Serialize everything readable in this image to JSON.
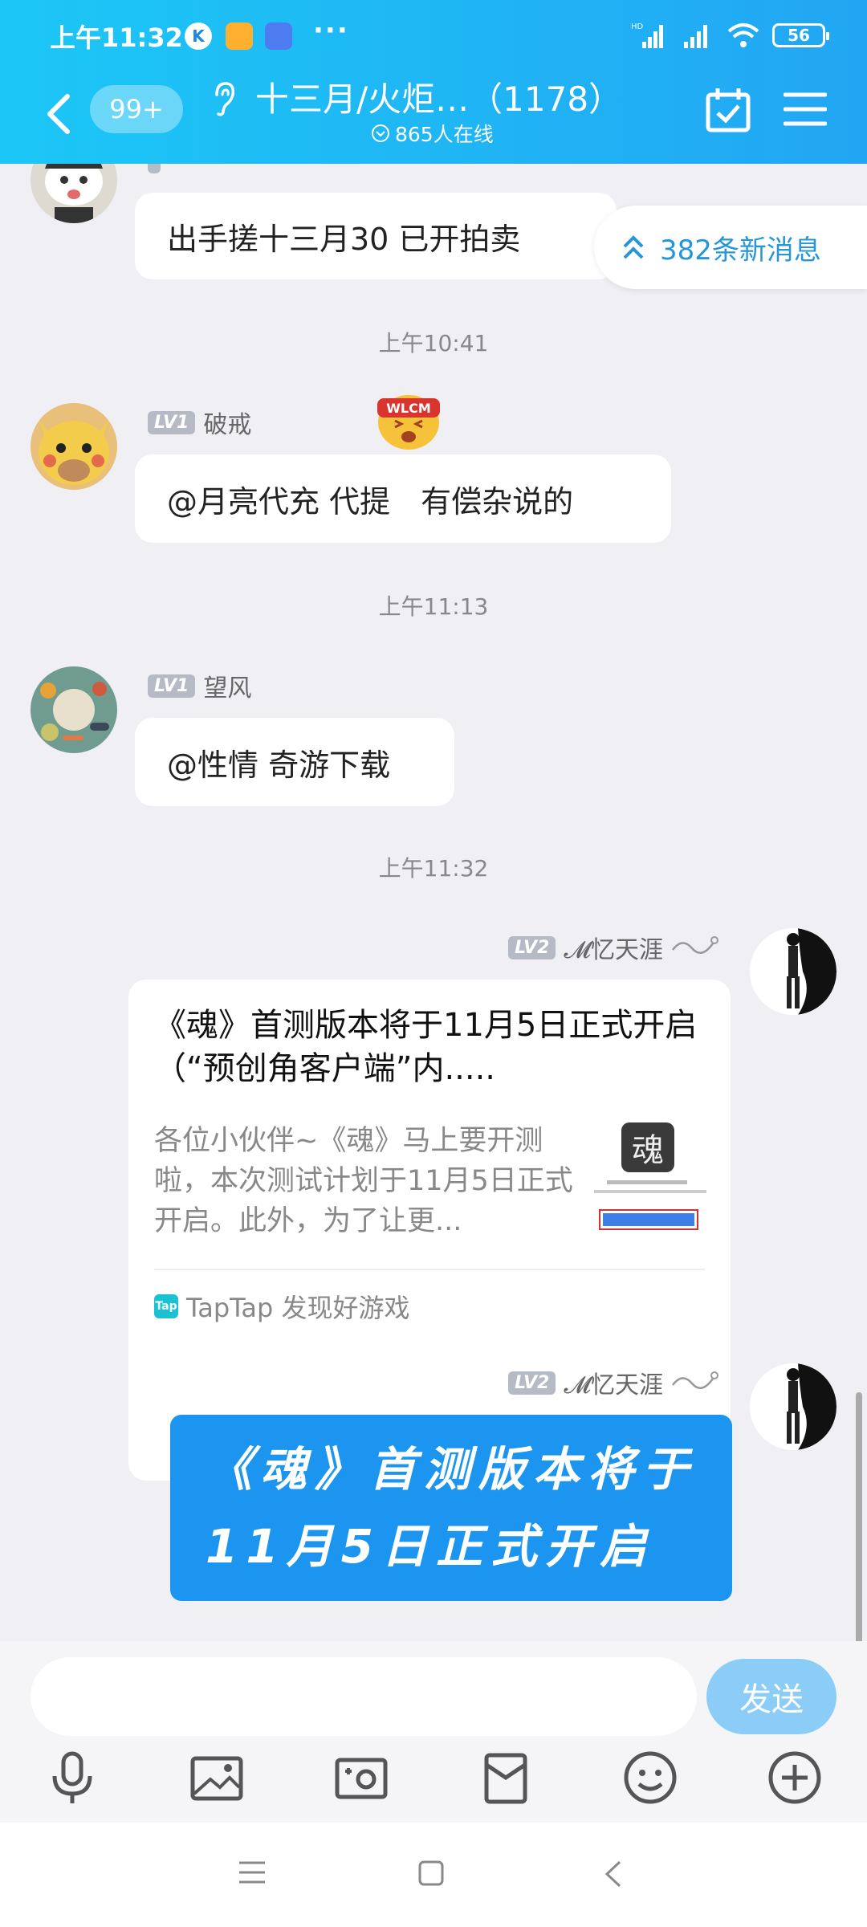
{
  "status_bar": {
    "time": "上午11:32",
    "more": "···",
    "network": "HD",
    "battery": "56"
  },
  "header": {
    "unread_badge": "99+",
    "title": "十三月/火炬…（1178）",
    "online": "865人在线"
  },
  "new_messages": "382条新消息",
  "messages": [
    {
      "text": "出手搓十三月30 已开拍卖"
    },
    {
      "time": "上午10:41",
      "level": "LV1",
      "sender": "破戒",
      "text": "@月亮代充 代提　有偿杂说的"
    },
    {
      "time": "上午11:13",
      "level": "LV1",
      "sender": "望风",
      "text": "@性情 奇游下载"
    },
    {
      "time": "上午11:32",
      "level": "LV2",
      "sender": "𝓜忆天涯",
      "card": {
        "title": "《魂》首测版本将于11月5日正式开启（“预创角客户端”内.....",
        "description": "各位小伙伴~《魂》马上要开测啦，本次测试计划于11月5日正式开启。此外，为了让更...",
        "thumb_char": "魂",
        "source_logo": "Tap",
        "source": "TapTap 发现好游戏"
      }
    },
    {
      "level": "LV2",
      "sender": "𝓜忆天涯",
      "text": "《魂》首测版本将于 11月5日正式开启"
    }
  ],
  "input": {
    "placeholder": "",
    "send_label": "发送"
  },
  "colors": {
    "header_start": "#1cc7f6",
    "header_end": "#22a6f3",
    "accent": "#2596d8",
    "image_bubble": "#1b95ef"
  },
  "toolbar_icons": [
    "mic-icon",
    "image-icon",
    "camera-icon",
    "red-packet-icon",
    "emoji-icon",
    "plus-icon"
  ]
}
